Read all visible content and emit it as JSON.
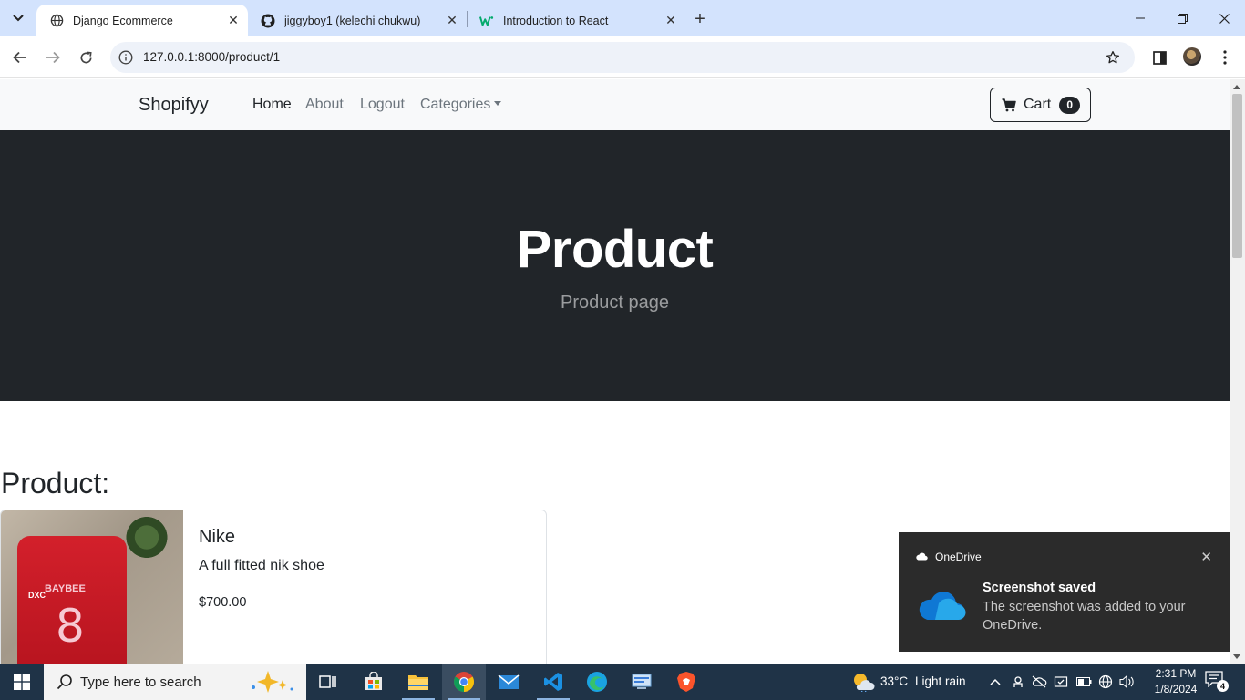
{
  "browser": {
    "tabs": [
      {
        "title": "Django Ecommerce",
        "icon": "globe-icon",
        "active": true
      },
      {
        "title": "jiggyboy1 (kelechi chukwu)",
        "icon": "github-icon",
        "active": false
      },
      {
        "title": "Introduction to React",
        "icon": "w3-icon",
        "active": false
      }
    ],
    "url": "127.0.0.1:8000/product/1"
  },
  "navbar": {
    "brand": "Shopifyy",
    "links": [
      "Home",
      "About",
      "Logout",
      "Categories"
    ],
    "cart_label": "Cart",
    "cart_count": "0"
  },
  "hero": {
    "title": "Product",
    "lead": "Product page"
  },
  "main": {
    "section_title": "Product:",
    "product": {
      "name": "Nike",
      "description": "A full fitted nik shoe",
      "price": "$700.00",
      "image_jersey_name": "BAYBEE",
      "image_jersey_number": "8",
      "image_jersey_sponsor": "DXC"
    }
  },
  "toast": {
    "app": "OneDrive",
    "title": "Screenshot saved",
    "message": "The screenshot was added to your OneDrive."
  },
  "taskbar": {
    "search_placeholder": "Type here to search",
    "weather_temp": "33°C",
    "weather_desc": "Light rain",
    "time": "2:31 PM",
    "date": "1/8/2024",
    "notification_count": "4"
  },
  "colors": {
    "hero_bg": "#212529",
    "tabstrip_bg": "#d3e3fd",
    "taskbar_bg": "#1f3347",
    "onedrive_blue": "#0f78d4"
  }
}
